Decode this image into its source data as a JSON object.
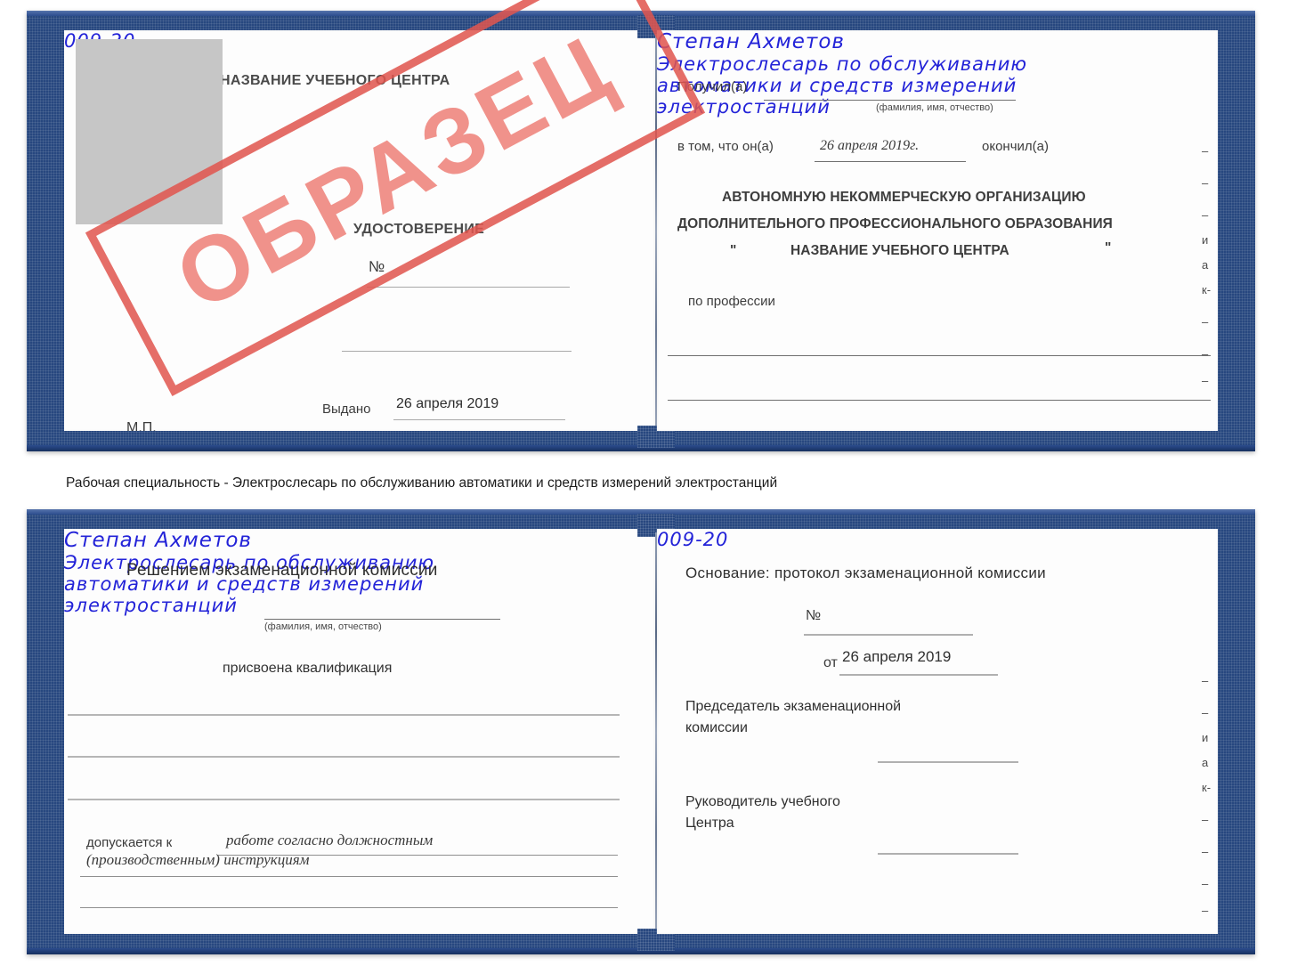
{
  "caption": {
    "text": "Рабочая специальность - Электрослесарь по обслуживанию автоматики и средств измерений электростанций"
  },
  "stamp": {
    "label": "ОБРАЗЕЦ",
    "color": "#e1564f"
  },
  "certificate_top": {
    "left_page": {
      "center_name": "НАЗВАНИЕ УЧЕБНОГО ЦЕНТРА",
      "doc_title": "УДОСТОВЕРЕНИЕ",
      "number_label": "№",
      "number_value": "009-20",
      "issued_label": "Выдано",
      "issued_value": "26 апреля 2019",
      "seal_label": "М.П."
    },
    "right_page": {
      "received_label": "Получил(а)",
      "received_value": "Степан Ахметов",
      "name_hint": "(фамилия, имя, отчество)",
      "in_that_label": "в том, что он(а)",
      "completion_date": "26 апреля 2019г.",
      "finished_label": "окончил(а)",
      "org_line1": "АВТОНОМНУЮ НЕКОММЕРЧЕСКУЮ ОРГАНИЗАЦИЮ",
      "org_line2": "ДОПОЛНИТЕЛЬНОГО ПРОФЕССИОНАЛЬНОГО ОБРАЗОВАНИЯ",
      "org_quote_open": "\"",
      "org_line3": "НАЗВАНИЕ УЧЕБНОГО ЦЕНТРА",
      "org_quote_close": "\"",
      "profession_label": "по профессии",
      "profession_line1": "Электрослесарь по обслуживанию",
      "profession_line2": "автоматики и средств измерений",
      "profession_line3": "электростанций",
      "margin_marks": [
        "–",
        "–",
        "–",
        "и",
        "а",
        "к-",
        "–",
        "–",
        "–",
        "–"
      ]
    }
  },
  "certificate_bottom": {
    "left_page": {
      "decision_title": "Решением экзаменационной комиссии",
      "name_value": "Степан Ахметов",
      "name_hint": "(фамилия, имя, отчество)",
      "qualification_label": "присвоена квалификация",
      "qualification_line1": "Электрослесарь по обслуживанию",
      "qualification_line2": "автоматики и средств измерений",
      "qualification_line3": "электростанций",
      "allowed_label": "допускается к",
      "allowed_line1": "работе согласно должностным",
      "allowed_line2": "(производственным) инструкциям"
    },
    "right_page": {
      "basis_label": "Основание: протокол экзаменационной комиссии",
      "number_label": "№",
      "number_value": "009-20",
      "date_label": "от",
      "date_value": "26 апреля 2019",
      "chairman_line1": "Председатель экзаменационной",
      "chairman_line2": "комиссии",
      "head_line1": "Руководитель учебного",
      "head_line2": "Центра",
      "margin_marks": [
        "–",
        "–",
        "и",
        "а",
        "к-",
        "–",
        "–",
        "–",
        "–"
      ]
    }
  }
}
